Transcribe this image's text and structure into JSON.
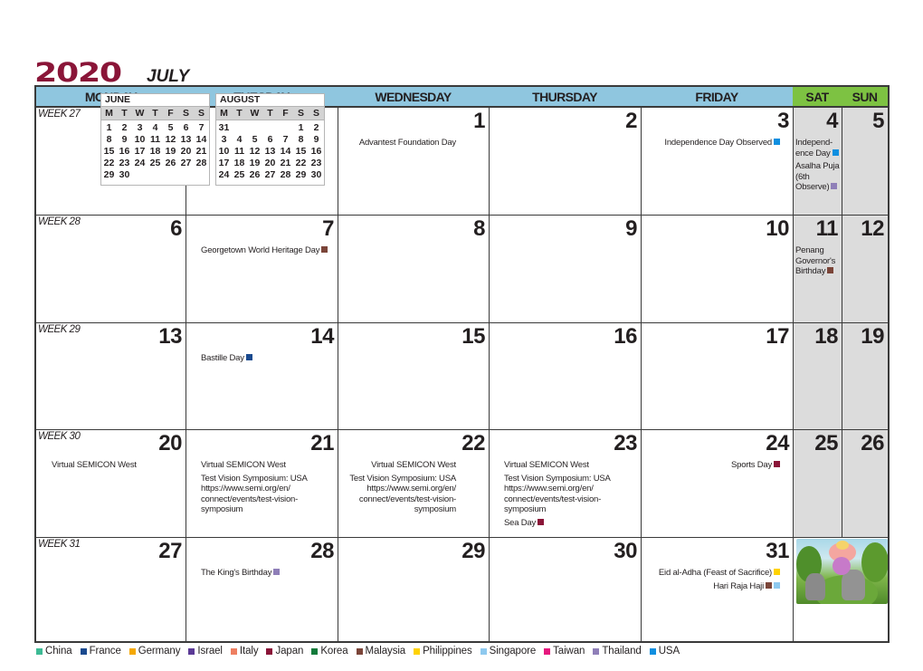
{
  "title": {
    "year": "2020",
    "month": "JULY"
  },
  "colors": {
    "year": "#8a1538",
    "header_weekday": "#8fc6df",
    "header_weekend": "#7dc242",
    "weekend_cell": "#dcdcdc"
  },
  "headers": [
    "MONDAY",
    "TUESDAY",
    "WEDNESDAY",
    "THURSDAY",
    "FRIDAY",
    "SAT",
    "SUN"
  ],
  "weeks": [
    {
      "label": "WEEK 27",
      "days": [
        null,
        null,
        "1",
        "2",
        "3",
        "4",
        "5"
      ]
    },
    {
      "label": "WEEK 28",
      "days": [
        "6",
        "7",
        "8",
        "9",
        "10",
        "11",
        "12"
      ]
    },
    {
      "label": "WEEK 29",
      "days": [
        "13",
        "14",
        "15",
        "16",
        "17",
        "18",
        "19"
      ]
    },
    {
      "label": "WEEK 30",
      "days": [
        "20",
        "21",
        "22",
        "23",
        "24",
        "25",
        "26"
      ]
    },
    {
      "label": "WEEK 31",
      "days": [
        "27",
        "28",
        "29",
        "30",
        "31",
        null,
        null
      ]
    }
  ],
  "mini_calendars": [
    {
      "name": "JUNE",
      "weekdays": [
        "M",
        "T",
        "W",
        "T",
        "F",
        "S",
        "S"
      ],
      "cells": [
        "1",
        "2",
        "3",
        "4",
        "5",
        "6",
        "7",
        "8",
        "9",
        "10",
        "11",
        "12",
        "13",
        "14",
        "15",
        "16",
        "17",
        "18",
        "19",
        "20",
        "21",
        "22",
        "23",
        "24",
        "25",
        "26",
        "27",
        "28",
        "29",
        "30",
        "",
        "",
        "",
        "",
        ""
      ]
    },
    {
      "name": "AUGUST",
      "weekdays": [
        "M",
        "T",
        "W",
        "T",
        "F",
        "S",
        "S"
      ],
      "cells": [
        "31",
        "",
        "",
        "",
        "",
        "1",
        "2",
        "3",
        "4",
        "5",
        "6",
        "7",
        "8",
        "9",
        "10",
        "11",
        "12",
        "13",
        "14",
        "15",
        "16",
        "17",
        "18",
        "19",
        "20",
        "21",
        "22",
        "23",
        "24",
        "25",
        "26",
        "27",
        "28",
        "29",
        "30"
      ]
    }
  ],
  "events": {
    "d1": [
      {
        "text": "Advantest Foundation Day",
        "countries": []
      }
    ],
    "d3": [
      {
        "text": "Independence Day Observed",
        "countries": [
          "USA"
        ]
      }
    ],
    "d4": [
      {
        "text": "Independ-ence Day",
        "countries": [
          "USA"
        ]
      },
      {
        "text": "Asalha Puja (6th Observe)",
        "countries": [
          "Thailand"
        ]
      }
    ],
    "d7": [
      {
        "text": "Georgetown World Heritage Day",
        "countries": [
          "Malaysia"
        ]
      }
    ],
    "d11": [
      {
        "text": "Penang Governor's Birthday",
        "countries": [
          "Malaysia"
        ]
      }
    ],
    "d14": [
      {
        "text": "Bastille Day",
        "countries": [
          "France"
        ]
      }
    ],
    "d20": [
      {
        "text": "Virtual SEMICON West",
        "countries": []
      }
    ],
    "d21": [
      {
        "text": "Virtual SEMICON West",
        "countries": []
      },
      {
        "text": "Test Vision Symposium: USA https://www.semi.org/en/ connect/events/test-vision-symposium",
        "countries": []
      }
    ],
    "d22": [
      {
        "text": "Virtual SEMICON West",
        "countries": []
      },
      {
        "text": "Test Vision Symposium: USA https://www.semi.org/en/ connect/events/test-vision-symposium",
        "countries": []
      }
    ],
    "d23": [
      {
        "text": "Virtual SEMICON West",
        "countries": []
      },
      {
        "text": "Test Vision Symposium: USA https://www.semi.org/en/ connect/events/test-vision-symposium",
        "countries": []
      },
      {
        "text": "Sea Day",
        "countries": [
          "Japan"
        ]
      }
    ],
    "d24": [
      {
        "text": "Sports Day",
        "countries": [
          "Japan"
        ]
      }
    ],
    "d28": [
      {
        "text": "The King's Birthday",
        "countries": [
          "Thailand"
        ]
      }
    ],
    "d31": [
      {
        "text": "Eid al-Adha (Feast of Sacrifice)",
        "countries": [
          "Philippines"
        ]
      },
      {
        "text": "Hari Raja Haji",
        "countries": [
          "Malaysia",
          "Singapore"
        ]
      }
    ]
  },
  "legend": [
    {
      "name": "China",
      "color": "#3dba94"
    },
    {
      "name": "France",
      "color": "#1a4a8f"
    },
    {
      "name": "Germany",
      "color": "#f5a800"
    },
    {
      "name": "Israel",
      "color": "#5b3a96"
    },
    {
      "name": "Italy",
      "color": "#ee7f61"
    },
    {
      "name": "Japan",
      "color": "#8a1538"
    },
    {
      "name": "Korea",
      "color": "#127a3b"
    },
    {
      "name": "Malaysia",
      "color": "#7b4539"
    },
    {
      "name": "Philippines",
      "color": "#ffd200"
    },
    {
      "name": "Singapore",
      "color": "#8ec9ef"
    },
    {
      "name": "Taiwan",
      "color": "#e6177d"
    },
    {
      "name": "Thailand",
      "color": "#8f7fb8"
    },
    {
      "name": "USA",
      "color": "#0f8fe0"
    }
  ],
  "photo": {
    "alt": "illustration-girl-on-bike-in-jungle"
  }
}
